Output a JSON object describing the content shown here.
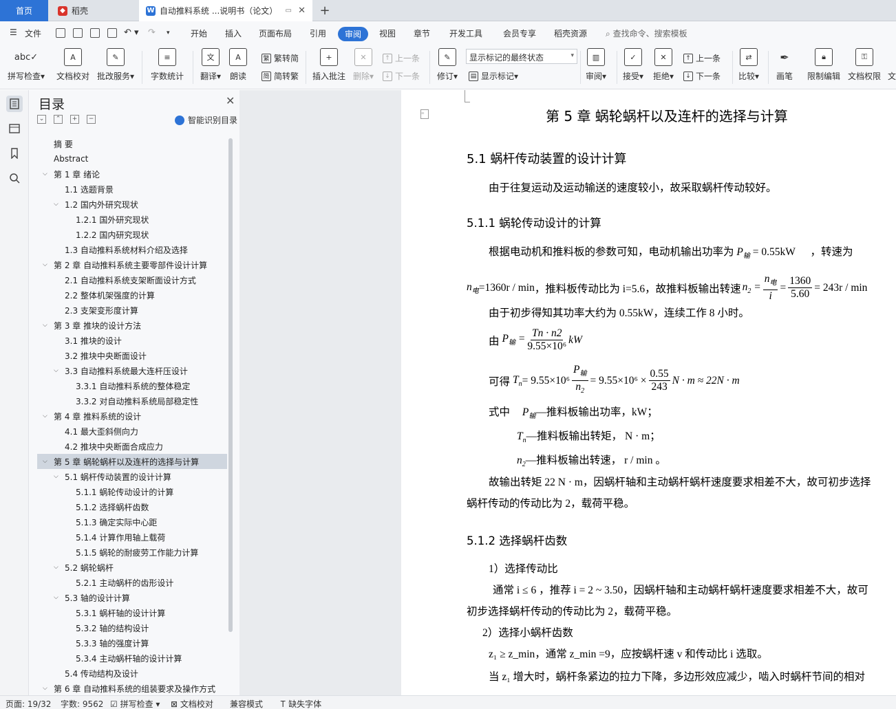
{
  "tabs": {
    "home": "首页",
    "daoke": "稻壳",
    "doc": "自动推料系统 ...说明书（论文）"
  },
  "menu": {
    "file": "文件",
    "items": [
      "开始",
      "插入",
      "页面布局",
      "引用",
      "审阅",
      "视图",
      "章节",
      "开发工具",
      "会员专享",
      "稻壳资源"
    ],
    "active": "审阅",
    "search": "查找命令、搜索模板"
  },
  "ribbon": {
    "spellcheck": "拼写检查",
    "doc_proof": "文档校对",
    "annotate_service": "批改服务",
    "word_count": "字数统计",
    "translate": "翻译",
    "read_aloud": "朗读",
    "to_traditional": "繁转简",
    "to_simplified": "简转繁",
    "insert_comment": "插入批注",
    "delete": "删除",
    "prev": "上一条",
    "next": "下一条",
    "track": "修订",
    "markup_state": "显示标记的最终状态",
    "show_markup": "显示标记",
    "review": "审阅",
    "accept": "接受",
    "reject": "拒绝",
    "prev2": "上一条",
    "next2": "下一条",
    "compare": "比较",
    "pen": "画笔",
    "restrict_edit": "限制编辑",
    "doc_rights": "文档权限",
    "more": "文"
  },
  "toc": {
    "title": "目录",
    "smart": "智能识别目录",
    "items": [
      {
        "label": "摘    要",
        "level": 0,
        "caret": ""
      },
      {
        "label": "Abstract",
        "level": 0,
        "caret": ""
      },
      {
        "label": "第 1 章  绪论",
        "level": 0,
        "caret": "v"
      },
      {
        "label": "1.1 选题背景",
        "level": 1,
        "caret": ""
      },
      {
        "label": "1.2 国内外研究现状",
        "level": 1,
        "caret": "v"
      },
      {
        "label": "1.2.1 国外研究现状",
        "level": 2,
        "caret": ""
      },
      {
        "label": "1.2.2 国内研究现状",
        "level": 2,
        "caret": ""
      },
      {
        "label": "1.3 自动推料系统材料介绍及选择",
        "level": 1,
        "caret": ""
      },
      {
        "label": "第 2 章  自动推料系统主要零部件设计计算",
        "level": 0,
        "caret": "v"
      },
      {
        "label": "2.1 自动推料系统支架断面设计方式",
        "level": 1,
        "caret": ""
      },
      {
        "label": "2.2 整体机架强度的计算",
        "level": 1,
        "caret": ""
      },
      {
        "label": "2.3 支架变形度计算",
        "level": 1,
        "caret": ""
      },
      {
        "label": "第 3 章  推块的设计方法",
        "level": 0,
        "caret": "v"
      },
      {
        "label": "3.1 推块的设计",
        "level": 1,
        "caret": ""
      },
      {
        "label": "3.2 推块中央断面设计",
        "level": 1,
        "caret": ""
      },
      {
        "label": "3.3 自动推料系统最大连杆压设计",
        "level": 1,
        "caret": "v"
      },
      {
        "label": "3.3.1 自动推料系统的整体稳定",
        "level": 2,
        "caret": ""
      },
      {
        "label": "3.3.2 对自动推料系统局部稳定性",
        "level": 2,
        "caret": ""
      },
      {
        "label": "第 4 章  推料系统的设计",
        "level": 0,
        "caret": "v"
      },
      {
        "label": "4.1 最大歪斜侧向力",
        "level": 1,
        "caret": ""
      },
      {
        "label": "4.2 推块中央断面合成应力",
        "level": 1,
        "caret": ""
      },
      {
        "label": "第 5 章  蜗轮蜗杆以及连杆的选择与计算",
        "level": 0,
        "caret": "v",
        "selected": true
      },
      {
        "label": "5.1 蜗杆传动装置的设计计算",
        "level": 1,
        "caret": "v"
      },
      {
        "label": "5.1.1 蜗轮传动设计的计算",
        "level": 2,
        "caret": ""
      },
      {
        "label": "5.1.2 选择蜗杆齿数",
        "level": 2,
        "caret": ""
      },
      {
        "label": "5.1.3 确定实际中心距",
        "level": 2,
        "caret": ""
      },
      {
        "label": "5.1.4 计算作用轴上载荷",
        "level": 2,
        "caret": ""
      },
      {
        "label": "5.1.5 蜗轮的耐疲劳工作能力计算",
        "level": 2,
        "caret": ""
      },
      {
        "label": "5.2 蜗轮蜗杆",
        "level": 1,
        "caret": "v"
      },
      {
        "label": "5.2.1 主动蜗杆的齿形设计",
        "level": 2,
        "caret": ""
      },
      {
        "label": "5.3 轴的设计计算",
        "level": 1,
        "caret": "v"
      },
      {
        "label": "5.3.1 蜗杆轴的设计计算",
        "level": 2,
        "caret": ""
      },
      {
        "label": "5.3.2 轴的结构设计",
        "level": 2,
        "caret": ""
      },
      {
        "label": "5.3.3 轴的强度计算",
        "level": 2,
        "caret": ""
      },
      {
        "label": "5.3.4 主动蜗杆轴的设计计算",
        "level": 2,
        "caret": ""
      },
      {
        "label": "5.4 传动结构及设计",
        "level": 1,
        "caret": ""
      },
      {
        "label": "第 6 章  自动推料系统的组装要求及操作方式",
        "level": 0,
        "caret": "v"
      }
    ]
  },
  "doc": {
    "chapter_title": "第 5 章  蜗轮蜗杆以及连杆的选择与计算",
    "s51": "5.1 蜗杆传动装置的设计计算",
    "s51_text": "由于往复运动及运动输送的速度较小，故采取蜗杆传动较好。",
    "s511": "5.1.1 蜗轮传动设计的计算",
    "p1a": "根据电动机和推料板的参数可知，电动机输出功率为",
    "p1_power": "= 0.55kW",
    "p1b": "，转速为",
    "p2_speed": "=1360r / min",
    "p2_mid": "，推料板传动比为 i=5.6，故推料板输出转速",
    "p2_num": "1360",
    "p2_den": "5.60",
    "p2_res": "= 243r / min",
    "p3": "由于初步得知其功率大约为 0.55kW，连续工作 8 小时。",
    "p4_lead": "由",
    "p4_num": "Tn · n2",
    "p4_den": "9.55×10⁶",
    "p4_unit": "kW",
    "p5_lead": "可得",
    "p5_mid": "= 9.55×10⁶",
    "p5_mid2": "= 9.55×10⁶ ×",
    "p5_num": "0.55",
    "p5_den": "243",
    "p5_res": "N · m ≈ 22N · m",
    "p6_lead": "式中",
    "p6_text": "—推料板输出功率，kW；",
    "p7_text": "—推料板输出转矩，  N · m；",
    "p8_text": "—推料板输出转速，  r / min  。",
    "p9": "故输出转矩 22 N · m，因蜗杆轴和主动蜗杆蜗杆速度要求相差不大，故可初步选择",
    "p10": "蜗杆传动的传动比为 2，载荷平稳。",
    "s512": "5.1.2 选择蜗杆齿数",
    "p11": "1）选择传动比",
    "p12": "通常 i ≤ 6  ，推荐 i = 2 ~ 3.50，因蜗杆轴和主动蜗杆蜗杆速度要求相差不大，故可",
    "p13": "初步选择蜗杆传动的传动比为 2，载荷平稳。",
    "p14": "2）选择小蜗杆齿数",
    "p15": "z₁ ≥ z_min，通常 z_min =9，应按蜗杆速 v 和传动比 i 选取。",
    "p16": "当 z₁  增大时，蜗杆条紧边的拉力下降，多边形效应减少，啮入时蜗杆节间的相对"
  },
  "status": {
    "page": "页面: 19/32",
    "words": "字数: 9562",
    "spellcheck": "拼写检查",
    "proof": "文档校对",
    "compat": "兼容模式",
    "missing_font": "缺失字体"
  }
}
